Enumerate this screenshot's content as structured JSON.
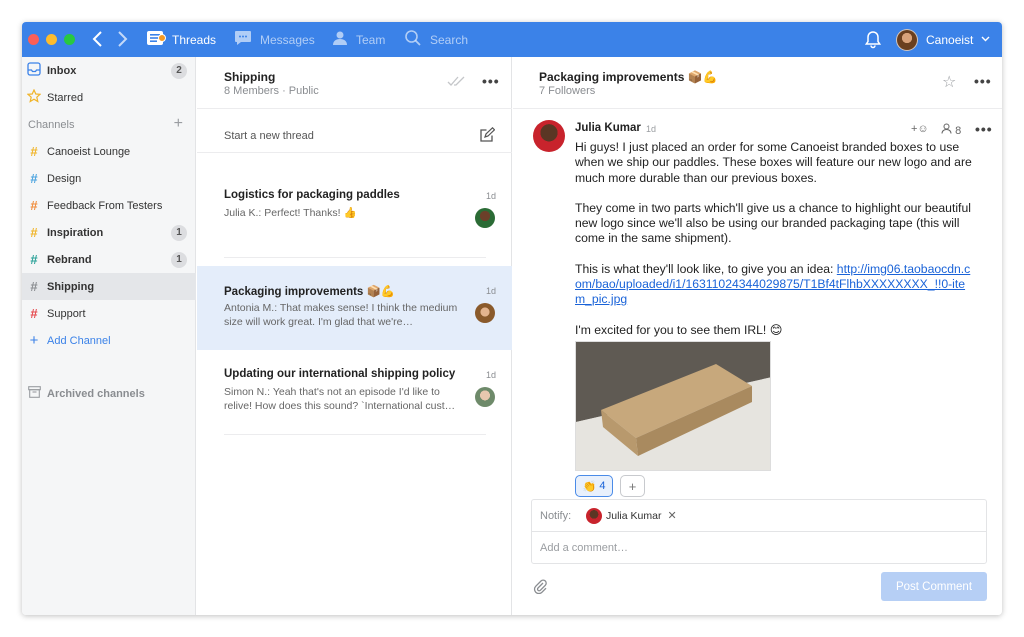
{
  "topbar": {
    "tabs": [
      {
        "label": "Threads",
        "icon": "threads-icon",
        "active": true
      },
      {
        "label": "Messages",
        "icon": "messages-icon"
      },
      {
        "label": "Team",
        "icon": "team-icon"
      },
      {
        "label": "Search",
        "icon": "search-icon"
      }
    ],
    "user_name": "Canoeist"
  },
  "sidebar": {
    "inbox": {
      "label": "Inbox",
      "count": "2"
    },
    "starred": {
      "label": "Starred"
    },
    "channels_heading": "Channels",
    "channels": [
      {
        "label": "Canoeist Lounge",
        "color": "#f0b429",
        "bold": false,
        "count": ""
      },
      {
        "label": "Design",
        "color": "#4aa3df",
        "bold": false,
        "count": ""
      },
      {
        "label": "Feedback From Testers",
        "color": "#f08c3c",
        "bold": false,
        "count": ""
      },
      {
        "label": "Inspiration",
        "color": "#f0b429",
        "bold": true,
        "count": "1"
      },
      {
        "label": "Rebrand",
        "color": "#2aa198",
        "bold": true,
        "count": "1"
      },
      {
        "label": "Shipping",
        "color": "#8a8d91",
        "bold": true,
        "count": "",
        "selected": true
      },
      {
        "label": "Support",
        "color": "#e5484d",
        "bold": false,
        "count": ""
      }
    ],
    "add_channel": "Add Channel",
    "archived": "Archived channels"
  },
  "threadlist": {
    "title": "Shipping",
    "subtitle": "8 Members · Public",
    "new_thread": "Start a new thread",
    "threads": [
      {
        "title": "Logistics for packaging paddles",
        "preview": "Julia K.: Perfect! Thanks! 👍",
        "time": "1d"
      },
      {
        "title": "Packaging improvements 📦💪",
        "preview": "Antonia M.: That makes sense! I think the medium size will work great. I'm glad that we're…",
        "time": "1d"
      },
      {
        "title": "Updating our international shipping policy",
        "preview": "Simon N.: Yeah that's not an episode I'd like to relive!  How does this sound? `International cust…",
        "time": "1d"
      }
    ]
  },
  "detail": {
    "title": "Packaging improvements 📦💪",
    "subtitle": "7 Followers",
    "message": {
      "author": "Julia Kumar",
      "time": "1d",
      "follower_count": "8",
      "react_add": "+☺",
      "p1": "Hi guys! I just placed an order for some Canoeist branded boxes to use when we ship our paddles. These boxes will feature our new logo and are much more durable than our previous boxes.",
      "p2": "They come in two parts which'll give us a chance to highlight our beautiful new logo since we'll also be using our branded packaging tape (this will come in the same shipment).",
      "p3_prefix": "This is what they'll look like, to give you an idea: ",
      "p3_link": "http://img06.taobaocdn.com/bao/uploaded/i1/16311024344029875/T1Bf4tFlhbXXXXXXXX_!!0-item_pic.jpg",
      "p4": "I'm excited for you to see them IRL! 😊"
    },
    "reaction": {
      "emoji": "👏",
      "count": "4",
      "add": "+"
    },
    "notify_label": "Notify:",
    "notify_person": "Julia Kumar",
    "comment_placeholder": "Add a comment…",
    "post_button": "Post Comment"
  }
}
